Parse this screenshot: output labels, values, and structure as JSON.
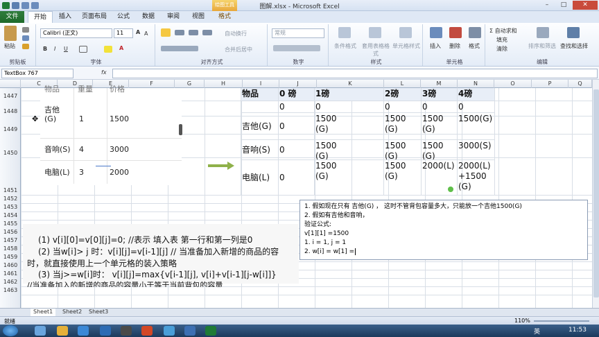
{
  "window": {
    "title": "图解.xlsx - Microsoft Excel",
    "context_tab": "绘图工具",
    "context_sub": "格式"
  },
  "tabs": [
    "文件",
    "开始",
    "插入",
    "页面布局",
    "公式",
    "数据",
    "审阅",
    "视图",
    "格式"
  ],
  "ribbon": {
    "paste": "粘贴",
    "clipboard": "剪贴板",
    "font_name": "Calibri (正文)",
    "font_size": "11",
    "font_group": "字体",
    "wrap": "自动换行",
    "merge": "合并后居中",
    "align_group": "对齐方式",
    "number_format": "常规",
    "number_group": "数字",
    "cond_format": "条件格式",
    "table_format": "套用表格格式",
    "cell_style": "单元格样式",
    "style_group": "样式",
    "insert": "插入",
    "delete": "删除",
    "format": "格式",
    "cells_group": "单元格",
    "autosum": "Σ 自动求和",
    "fill": "填充",
    "clear": "清除",
    "sort": "排序和筛选",
    "find": "查找和选择",
    "edit_group": "编辑",
    "bold": "B",
    "italic": "I",
    "underline": "U",
    "grow": "A",
    "shrink": "A",
    "font_color": "A"
  },
  "formula_bar": {
    "name_box": "TextBox 767",
    "fx": "fx",
    "content": ""
  },
  "columns": [
    "C",
    "D",
    "E",
    "F",
    "G",
    "H",
    "I",
    "J",
    "K",
    "L",
    "M",
    "N",
    "O",
    "P",
    "Q"
  ],
  "rows": [
    "1447",
    "1448",
    "1449",
    "1450",
    "1451",
    "1452",
    "1453",
    "1454",
    "1455",
    "1456",
    "1457",
    "1458",
    "1459",
    "1460",
    "1461",
    "1462",
    "1463"
  ],
  "left_table": {
    "header": [
      "物品",
      "重量",
      "价格"
    ],
    "items": [
      {
        "name": "吉他\n(G)",
        "weight": "1",
        "price": "1500"
      },
      {
        "name": "音响(S)",
        "weight": "4",
        "price": "3000"
      },
      {
        "name": "电脑(L)",
        "weight": "3",
        "price": "2000"
      }
    ]
  },
  "dp_table": {
    "header": [
      "物品",
      "0 磅",
      "1磅",
      "2磅",
      "3磅",
      "4磅"
    ],
    "rows": [
      [
        "",
        "0",
        "0",
        "0",
        "0",
        "0"
      ],
      [
        "吉他(G)",
        "0",
        "1500(G)",
        "1500(G)",
        "1500(G)",
        "1500(G)"
      ],
      [
        "音响(S)",
        "0",
        "1500(G)",
        "1500(G)",
        "1500(G)",
        "3000(S)"
      ],
      [
        "电脑(L)",
        "0",
        "1500(G)",
        "1500(G)",
        "2000(L)",
        "2000(L)+1500(G)"
      ]
    ]
  },
  "notes": [
    "(1)  v[i][0]=v[0][j]=0; //表示 填入表 第一行和第一列是0",
    "(2) 当w[i]> j 时：v[i][j]=v[i-1][j]  // 当准备加入新增的商品的容",
    "时，就直接使用上一个单元格的装入策略",
    "(3) 当j>=w[i]时：  v[i][j]=max{v[i-1][j], v[i]+v[i-1][j-w[i]]}",
    "//当准备加入的新增的商品的容量小于等于当前背包的容量"
  ],
  "textbox_lines": [
    "1. 假如现在只有  吉他(G) ，  这时不管背包容量多大，只能放一个吉他1500(G)",
    "2. 假如有吉他和音响，",
    "验证公式:",
    "v[1][1] =1500",
    "1. i = 1, j = 1",
    "2. w[i] = w[1] ="
  ],
  "sheet_tabs": [
    "Sheet1",
    "Sheet2",
    "Sheet3"
  ],
  "status": {
    "ready": "就绪",
    "zoom": "110%"
  },
  "taskbar": {
    "time": "11:53",
    "lang": "英"
  },
  "colors": {
    "file_tab": "#1f6a2b",
    "arrow": "#8fb14a",
    "accent": "#2b579a"
  }
}
